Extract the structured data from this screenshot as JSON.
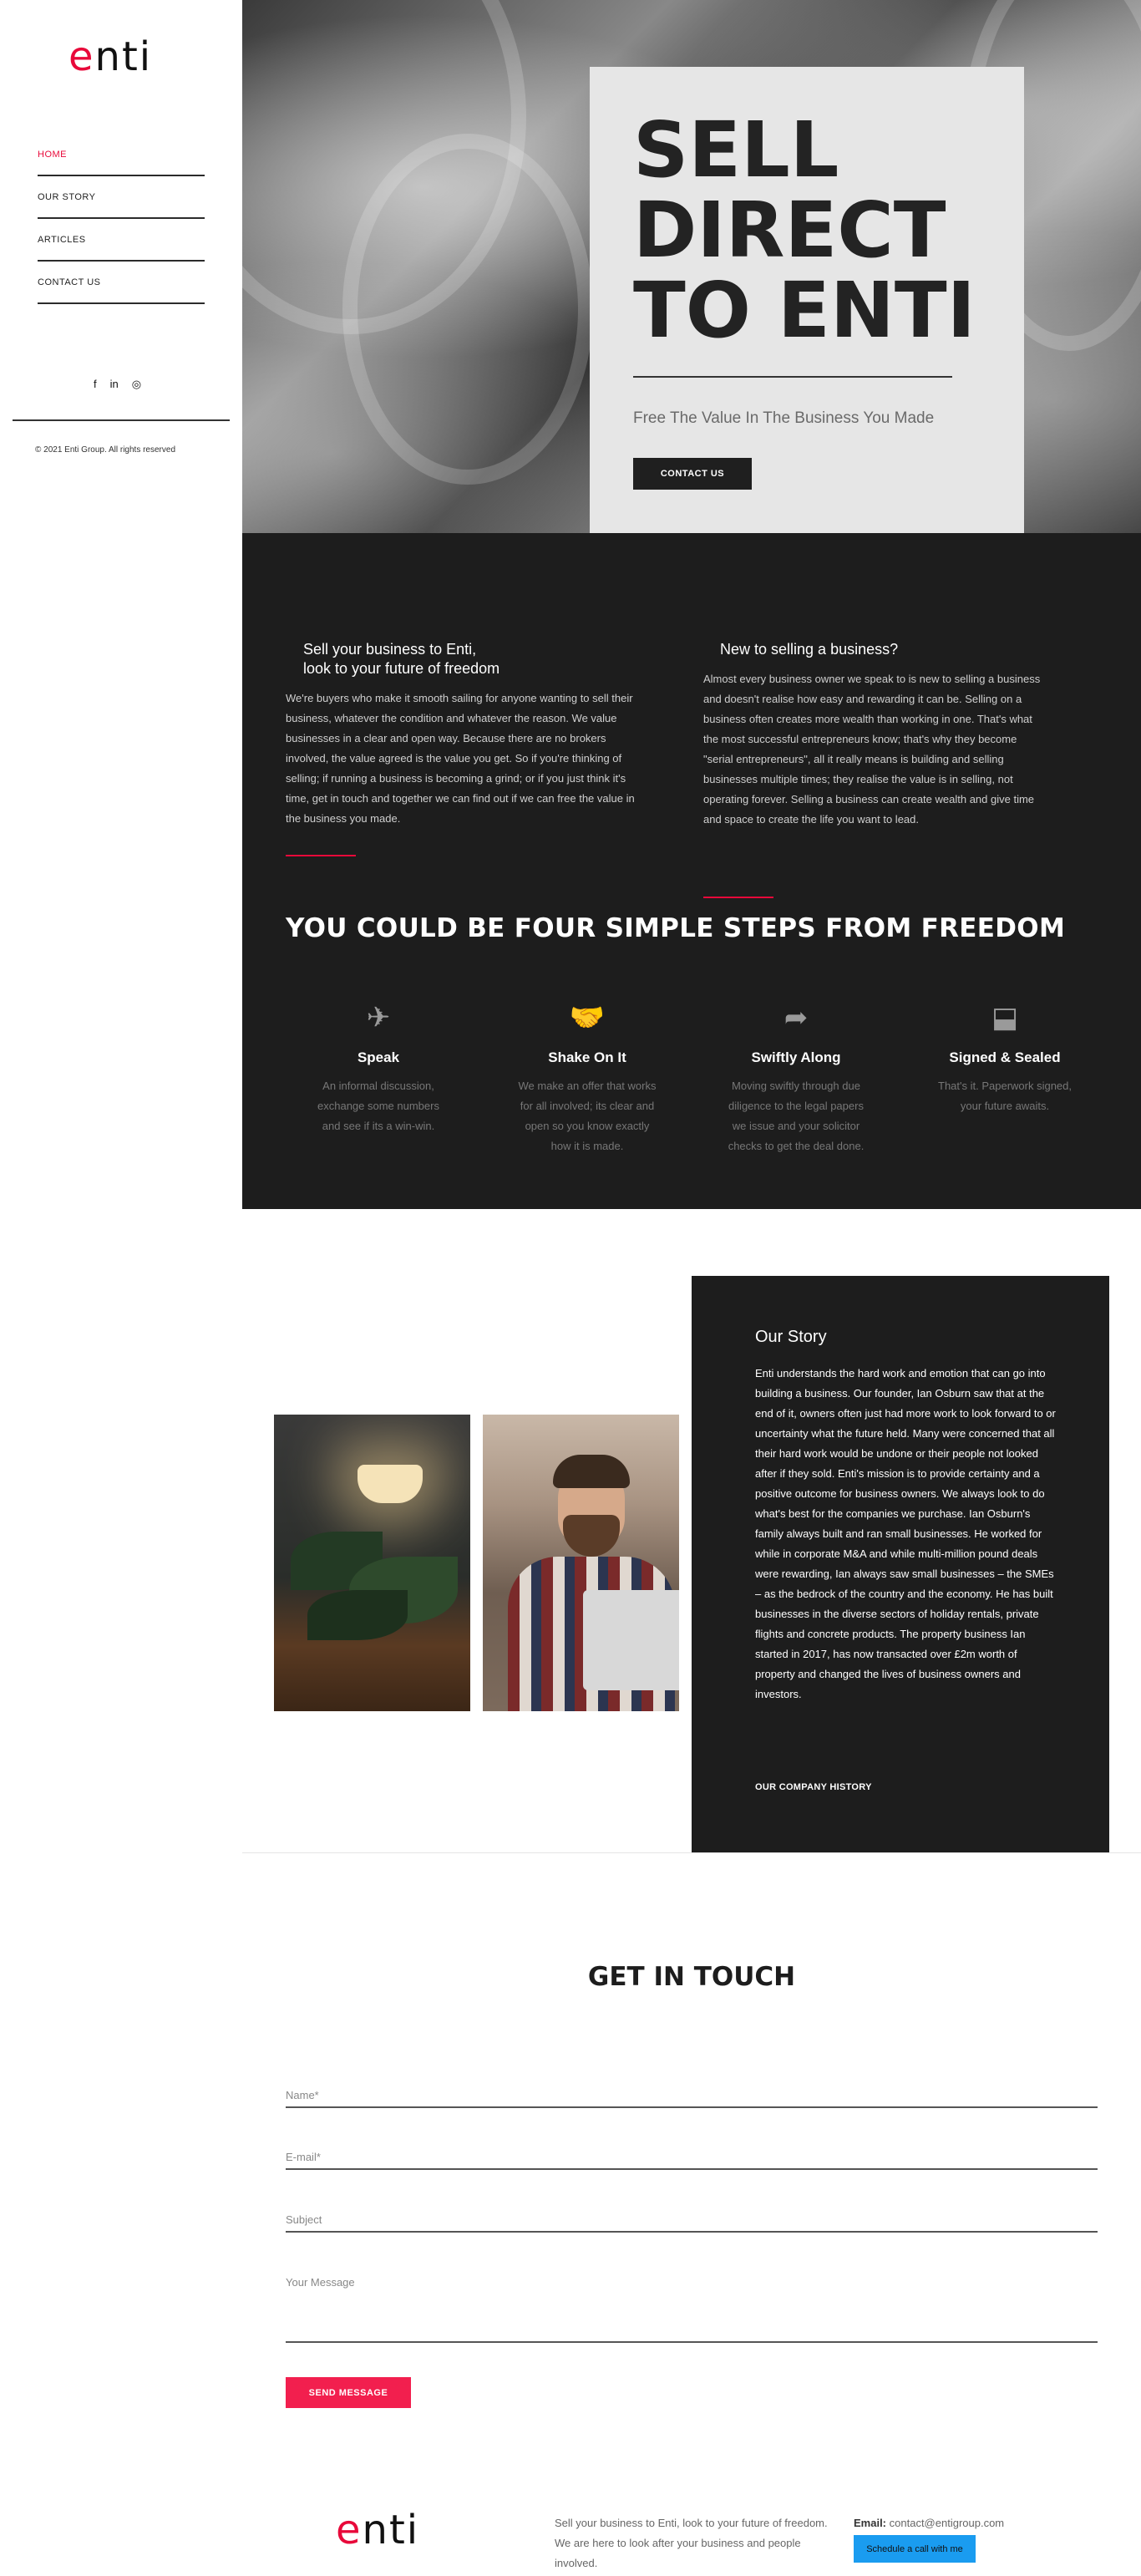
{
  "brand": {
    "logo_pre": "",
    "logo_red": "e",
    "logo_post": "nti",
    "accent": "#e8093a"
  },
  "sidebar": {
    "nav": [
      {
        "label": "HOME",
        "active": true
      },
      {
        "label": "OUR STORY"
      },
      {
        "label": "ARTICLES"
      },
      {
        "label": "CONTACT US"
      }
    ],
    "socials": [
      "f",
      "in",
      "◎"
    ],
    "copyright": "© 2021 Enti Group. All rights reserved"
  },
  "hero": {
    "title_line1": "SELL",
    "title_line2": "DIRECT",
    "title_line3": "TO ENTI",
    "subtitle": "Free The Value In The Business You Made",
    "button": "CONTACT US"
  },
  "intro": {
    "left_title_1": "Sell your business to Enti,",
    "left_title_2": "look to your future of freedom",
    "left_text": "We're buyers who make it smooth sailing for anyone wanting to sell their business, whatever the condition and whatever the reason. We value businesses in a clear and open way. Because there are no brokers involved, the value agreed is the value you get. So if you're thinking of selling; if running a business is becoming a grind; or if you just think it's time, get in touch and together we can find out if we can free the value in the business you made.",
    "right_title": "New to selling a business?",
    "right_text": "Almost every business owner we speak to is new to selling a business and doesn't realise how easy and rewarding it can be. Selling on a business often creates more wealth than working in one. That's what the most successful entrepreneurs know; that's why they become \"serial entrepreneurs\", all it really means is building and selling businesses multiple times; they realise the value is in selling, not operating forever. Selling a business can create wealth and give time and space to create the life you want to lead."
  },
  "steps": {
    "title": "YOU COULD BE FOUR SIMPLE STEPS FROM FREEDOM",
    "items": [
      {
        "icon": "paper-plane-icon",
        "glyph": "✈",
        "name": "Speak",
        "text": "An informal discussion, exchange some numbers and see if its a win-win."
      },
      {
        "icon": "handshake-icon",
        "glyph": "🤝",
        "name": "Shake On It",
        "text": "We make an offer that works for all involved; its clear and open so you know exactly how it is made."
      },
      {
        "icon": "share-arrow-icon",
        "glyph": "➦",
        "name": "Swiftly Along",
        "text": "Moving swiftly through due diligence to the legal papers we issue and your solicitor checks to get the deal done."
      },
      {
        "icon": "stamp-icon",
        "glyph": "⬓",
        "name": "Signed & Sealed",
        "text": "That's it. Paperwork signed, your future awaits."
      }
    ]
  },
  "story": {
    "title": "Our Story",
    "text": "Enti understands the hard work and emotion that can go into building a business. Our founder, Ian Osburn saw that at the end of it, owners often just had more work to look forward to or uncertainty what the future held. Many were concerned that all their hard work would be undone or their people not looked after if they sold. Enti's mission is to provide certainty and a positive outcome for business owners. We always look to do what's best for the companies we purchase. Ian Osburn's family always built and ran small businesses. He worked for while in corporate M&A and while multi-million pound deals were rewarding, Ian always saw small businesses – the SMEs – as the bedrock of the country and the economy. He has built businesses in the diverse sectors of holiday rentals, private flights and concrete products. The property business Ian started in 2017, has now transacted over £2m worth of property and changed the lives of business owners and investors.",
    "link": "OUR COMPANY HISTORY"
  },
  "contact": {
    "title": "GET IN TOUCH",
    "name_placeholder": "Name*",
    "email_placeholder": "E-mail*",
    "subject_placeholder": "Subject",
    "message_placeholder": "Your Message",
    "button": "SEND MESSAGE"
  },
  "footer": {
    "text": "Sell your business to Enti, look to your future of freedom. We are here to look after your business and people involved.",
    "email_label": "Email:",
    "email": "contact@entigroup.com",
    "schedule": "Schedule a call with me"
  }
}
